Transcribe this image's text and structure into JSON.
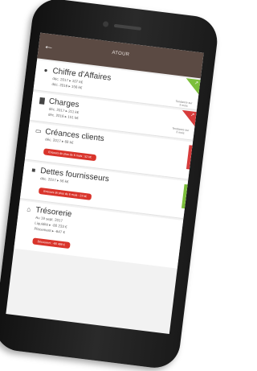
{
  "app": {
    "title": "ATOUR"
  },
  "icons": {
    "back": "arrow-left-icon"
  },
  "colors": {
    "appbar": "#5b4a43",
    "alert": "#d9342b",
    "positive": "#7cbf3b",
    "negative": "#d63b3b"
  },
  "cards": [
    {
      "title": "Chiffre d'Affaires",
      "icon": "coins-icon",
      "lines": [
        "déc. 2017 ▸ 107 k€",
        "déc. 2016 ▸ 156 k€"
      ],
      "trend": "Tendance sur 3 mois",
      "trend_color": "positive"
    },
    {
      "title": "Charges",
      "icon": "bar-chart-icon",
      "lines": [
        "déc. 2017 ▸ 211 k€",
        "déc. 2016 ▸ 151 k€"
      ],
      "trend": "Tendance sur 3 mois",
      "trend_color": "negative"
    },
    {
      "title": "Créances clients",
      "icon": "card-icon",
      "lines": [
        "déc. 2017 ▸ 68 k€"
      ],
      "pill": "Encours de plus de 6 mois : 52 k€"
    },
    {
      "title": "Dettes fournisseurs",
      "icon": "truck-icon",
      "lines": [
        "déc. 2017 ▸ 56 k€"
      ],
      "pill": "Encours de plus de 6 mois : 23 k€"
    },
    {
      "title": "Trésorerie",
      "icon": "bank-icon",
      "lines": [
        "Au 19 sept. 2017",
        "Liquidité ▸ -80 233 €",
        "Placement ▸ -647 €"
      ],
      "pill": "Découvert : -80 499 €"
    }
  ]
}
